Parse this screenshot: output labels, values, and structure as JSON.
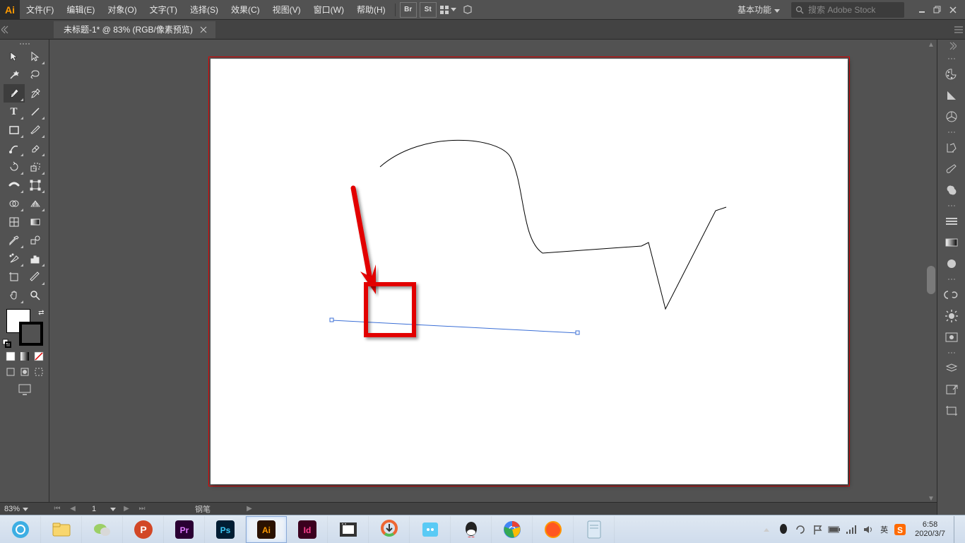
{
  "app_icon_label": "Ai",
  "menu": {
    "file": "文件(F)",
    "edit": "编辑(E)",
    "object": "对象(O)",
    "type": "文字(T)",
    "select": "选择(S)",
    "effect": "效果(C)",
    "view": "视图(V)",
    "window": "窗口(W)",
    "help": "帮助(H)"
  },
  "header_icons": {
    "br": "Br",
    "st": "St"
  },
  "workspace": "基本功能",
  "search_placeholder": "搜索 Adobe Stock",
  "document_tab": "未标题-1* @ 83% (RGB/像素预览)",
  "status": {
    "zoom": "83%",
    "artboard_num": "1",
    "tool": "钢笔"
  },
  "taskbar": {
    "ime": "英",
    "time": "6:58",
    "date": "2020/3/7"
  },
  "tool_names": {
    "selection": "selection-tool",
    "direct": "direct-selection-tool",
    "magic": "magic-wand-tool",
    "lasso": "lasso-tool",
    "pen": "pen-tool",
    "curvature": "curvature-tool",
    "type": "type-tool",
    "line": "line-segment-tool",
    "rect": "rectangle-tool",
    "brush": "paintbrush-tool",
    "shaper": "shaper-tool",
    "eraser": "eraser-tool",
    "rotate": "rotate-tool",
    "scale": "scale-tool",
    "width": "width-tool",
    "freetrans": "free-transform-tool",
    "shapebuilder": "shape-builder-tool",
    "persp": "perspective-grid-tool",
    "mesh": "mesh-tool",
    "gradient": "gradient-tool",
    "eyedrop": "eyedropper-tool",
    "blend": "blend-tool",
    "symbol": "symbol-sprayer-tool",
    "graph": "column-graph-tool",
    "artboard": "artboard-tool",
    "slice": "slice-tool",
    "hand": "hand-tool",
    "zoomtool": "zoom-tool"
  }
}
